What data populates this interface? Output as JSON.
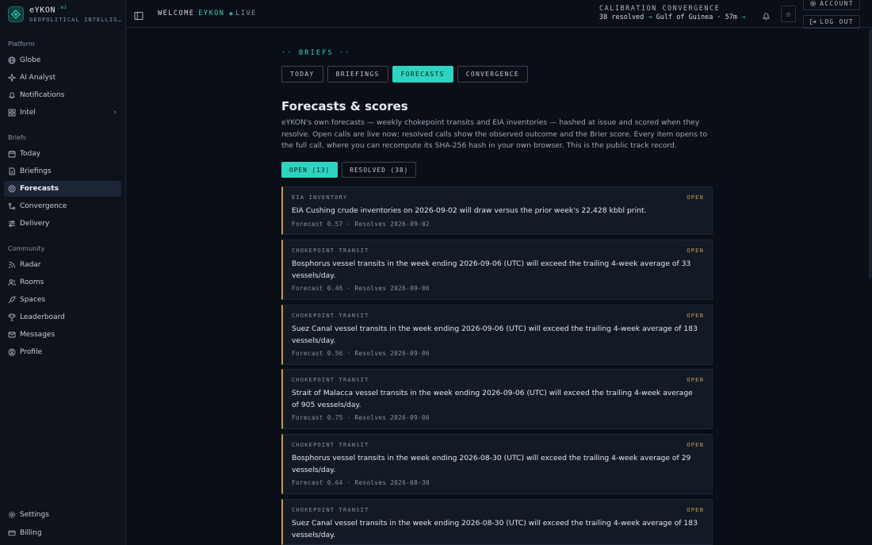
{
  "brand": {
    "name": "eYKON",
    "suffix": ".ai",
    "subtitle": "GEOPOLITICAL INTELLIG…"
  },
  "sidebar": {
    "platform_label": "Platform",
    "platform": [
      {
        "label": "Globe",
        "icon": "globe-icon"
      },
      {
        "label": "AI Analyst",
        "icon": "sparkle-icon"
      },
      {
        "label": "Notifications",
        "icon": "bell-icon"
      },
      {
        "label": "Intel",
        "icon": "grid-icon"
      }
    ],
    "briefs_label": "Briefs",
    "briefs": [
      {
        "label": "Today",
        "icon": "calendar-icon"
      },
      {
        "label": "Briefings",
        "icon": "document-icon"
      },
      {
        "label": "Forecasts",
        "icon": "target-icon"
      },
      {
        "label": "Convergence",
        "icon": "convergence-icon"
      },
      {
        "label": "Delivery",
        "icon": "sliders-icon"
      }
    ],
    "community_label": "Community",
    "community": [
      {
        "label": "Radar",
        "icon": "radar-icon"
      },
      {
        "label": "Rooms",
        "icon": "users-icon"
      },
      {
        "label": "Spaces",
        "icon": "rocket-icon"
      },
      {
        "label": "Leaderboard",
        "icon": "trophy-icon"
      },
      {
        "label": "Messages",
        "icon": "mail-icon"
      },
      {
        "label": "Profile",
        "icon": "user-circle-icon"
      }
    ],
    "footer": [
      {
        "label": "Settings",
        "icon": "gear-icon"
      },
      {
        "label": "Billing",
        "icon": "card-icon"
      }
    ]
  },
  "topbar": {
    "welcome": "WELCOME",
    "user": "EYKON",
    "live": "LIVE",
    "calibration_line1": "CALIBRATION  CONVERGENCE",
    "calibration_resolved": "38 resolved",
    "calibration_detail": "Gulf of Guinea · 57m",
    "account": "ACCOUNT",
    "logout": "LOG OUT",
    "square_button": "◫"
  },
  "page": {
    "section_label": "·· BRIEFS ··",
    "tabs": [
      "TODAY",
      "BRIEFINGS",
      "FORECASTS",
      "CONVERGENCE"
    ],
    "active_tab": "FORECASTS",
    "title": "Forecasts & scores",
    "intro": "eYKON's own forecasts — weekly chokepoint transits and EIA inventories — hashed at issue and scored when they resolve. Open calls are live now; resolved calls show the observed outcome and the Brier score. Every item opens to the full call, where you can recompute its SHA-256 hash in your own browser. This is the public track record.",
    "filters": [
      "OPEN (13)",
      "RESOLVED (38)"
    ]
  },
  "forecasts": [
    {
      "kind": "EIA INVENTORY",
      "status": "OPEN",
      "claim": "EIA Cushing crude inventories on 2026-09-02 will draw versus the prior week's 22,428 kbbl print.",
      "meta": "Forecast 0.57 · Resolves 2026-09-02"
    },
    {
      "kind": "CHOKEPOINT TRANSIT",
      "status": "OPEN",
      "claim": "Bosphorus vessel transits in the week ending 2026-09-06 (UTC) will exceed the trailing 4-week average of 33 vessels/day.",
      "meta": "Forecast 0.46 · Resolves 2026-09-06"
    },
    {
      "kind": "CHOKEPOINT TRANSIT",
      "status": "OPEN",
      "claim": "Suez Canal vessel transits in the week ending 2026-09-06 (UTC) will exceed the trailing 4-week average of 183 vessels/day.",
      "meta": "Forecast 0.56 · Resolves 2026-09-06"
    },
    {
      "kind": "CHOKEPOINT TRANSIT",
      "status": "OPEN",
      "claim": "Strait of Malacca vessel transits in the week ending 2026-09-06 (UTC) will exceed the trailing 4-week average of 905 vessels/day.",
      "meta": "Forecast 0.75 · Resolves 2026-09-06"
    },
    {
      "kind": "CHOKEPOINT TRANSIT",
      "status": "OPEN",
      "claim": "Bosphorus vessel transits in the week ending 2026-08-30 (UTC) will exceed the trailing 4-week average of 29 vessels/day.",
      "meta": "Forecast 0.64 · Resolves 2026-08-30"
    },
    {
      "kind": "CHOKEPOINT TRANSIT",
      "status": "OPEN",
      "claim": "Suez Canal vessel transits in the week ending 2026-08-30 (UTC) will exceed the trailing 4-week average of 183 vessels/day.",
      "meta": ""
    }
  ],
  "colors": {
    "accent": "#2dd4bf",
    "open": "#c89a48",
    "background": "#0a0e16"
  }
}
